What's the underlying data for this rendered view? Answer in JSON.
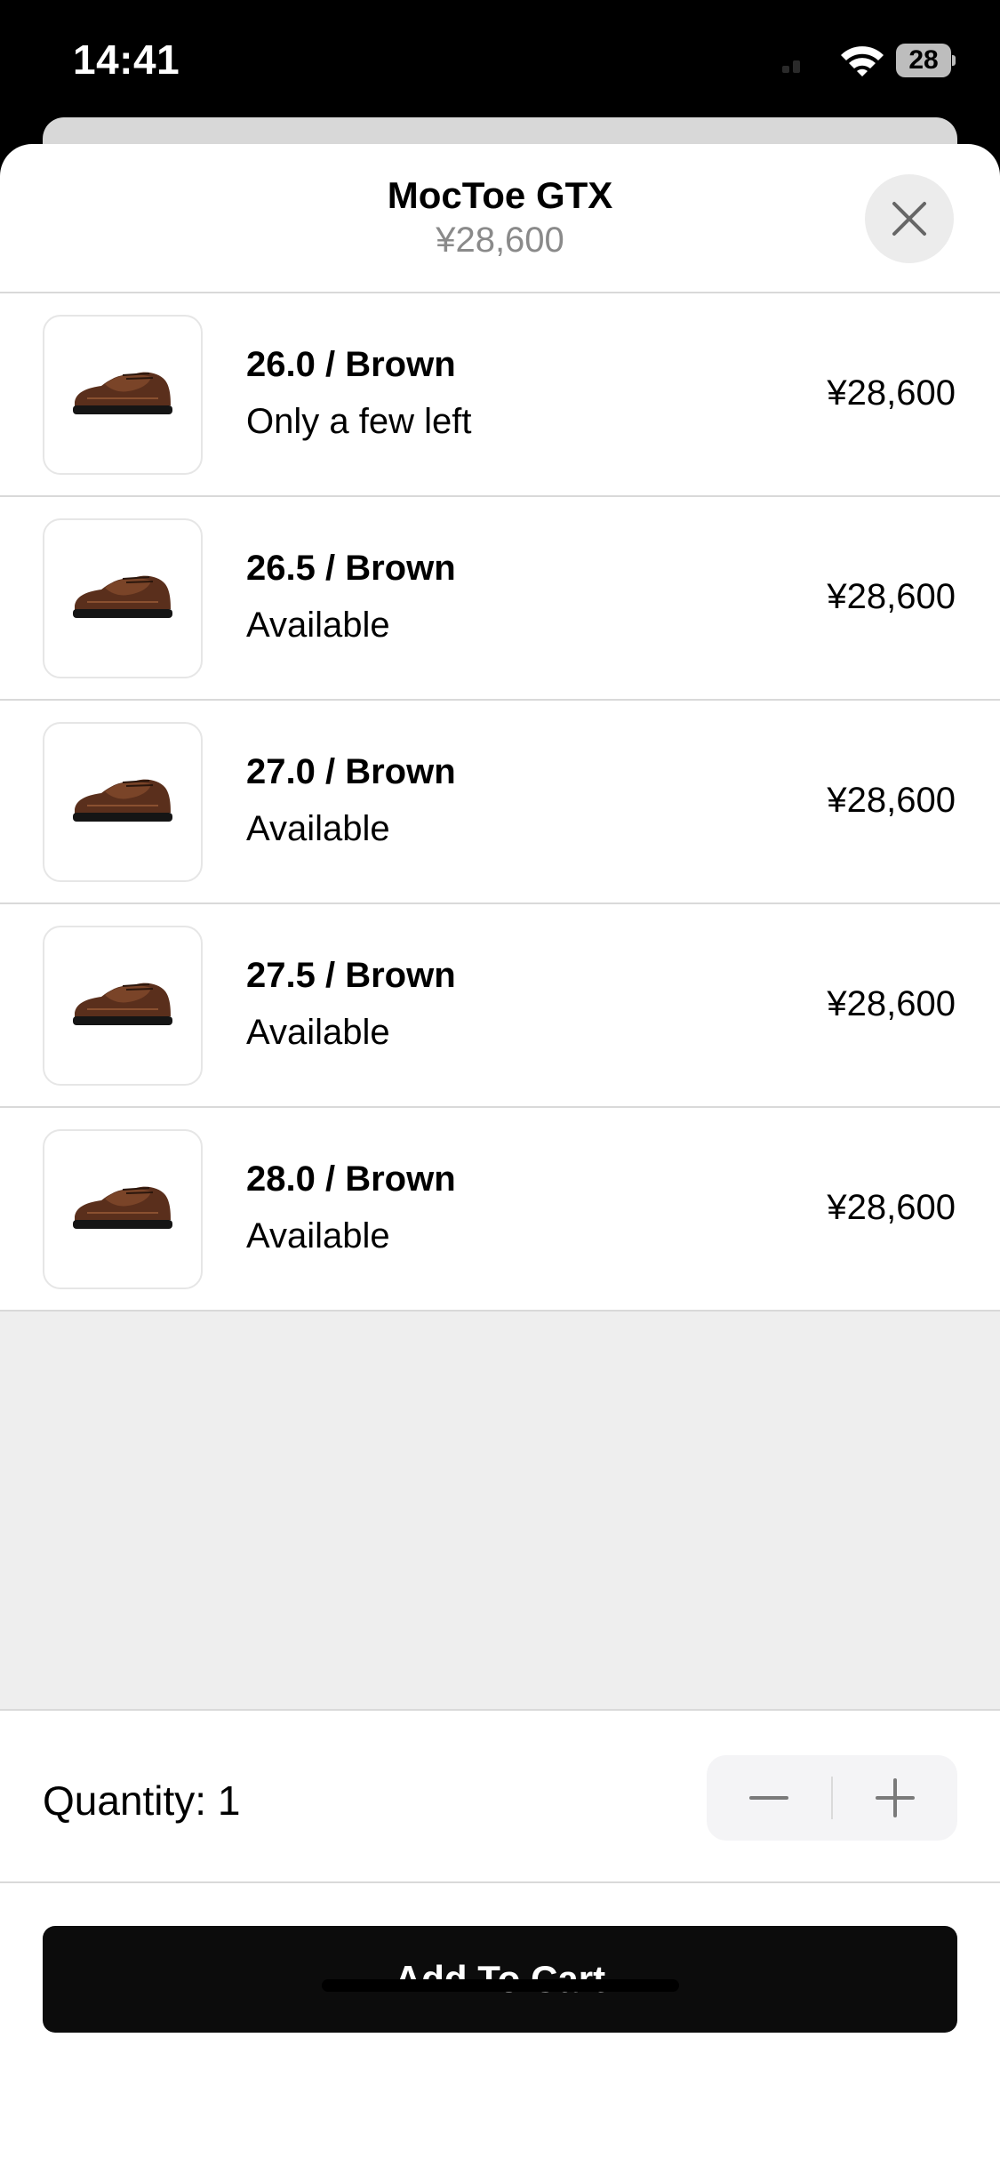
{
  "status_bar": {
    "time": "14:41",
    "battery": "28"
  },
  "header": {
    "product_name": "MocToe GTX",
    "product_price": "¥28,600"
  },
  "variants": [
    {
      "title": "26.0 / Brown",
      "status": "Only a few left",
      "price": "¥28,600"
    },
    {
      "title": "26.5 / Brown",
      "status": "Available",
      "price": "¥28,600"
    },
    {
      "title": "27.0 / Brown",
      "status": "Available",
      "price": "¥28,600"
    },
    {
      "title": "27.5 / Brown",
      "status": "Available",
      "price": "¥28,600"
    },
    {
      "title": "28.0 / Brown",
      "status": "Available",
      "price": "¥28,600"
    }
  ],
  "quantity": {
    "label": "Quantity: 1",
    "value": 1
  },
  "actions": {
    "add_to_cart_label": "Add To Cart"
  },
  "icons": {
    "close": "close-icon",
    "minus": "minus-icon",
    "plus": "plus-icon",
    "wifi": "wifi-icon",
    "battery": "battery-icon",
    "product_image": "shoe-image"
  },
  "colors": {
    "button": "#0c0c0c",
    "price_muted": "#8a8a8a",
    "background_empty": "#eeeeee"
  }
}
